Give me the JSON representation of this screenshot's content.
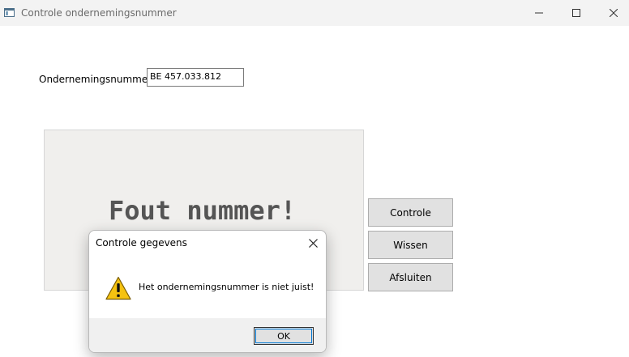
{
  "window": {
    "title": "Controle ondernemingsnummer",
    "icon": "app-window-icon",
    "controls": [
      "minimize-icon",
      "maximize-icon",
      "close-icon"
    ]
  },
  "form": {
    "label": "Ondernemingsnummer",
    "input_value": "BE 457.033.812"
  },
  "result": {
    "text": "Fout nummer!"
  },
  "buttons": {
    "controle": "Controle",
    "wissen": "Wissen",
    "afsluiten": "Afsluiten"
  },
  "dialog": {
    "title": "Controle gegevens",
    "message": "Het ondernemingsnummer is niet juist!",
    "ok_label": "OK",
    "icon": "warning-icon"
  },
  "colors": {
    "titlebar": "#f3f3f3",
    "panel": "#f0efed",
    "button": "#e1e1e1",
    "focus": "#0078d4",
    "warning": "#f5c211"
  }
}
